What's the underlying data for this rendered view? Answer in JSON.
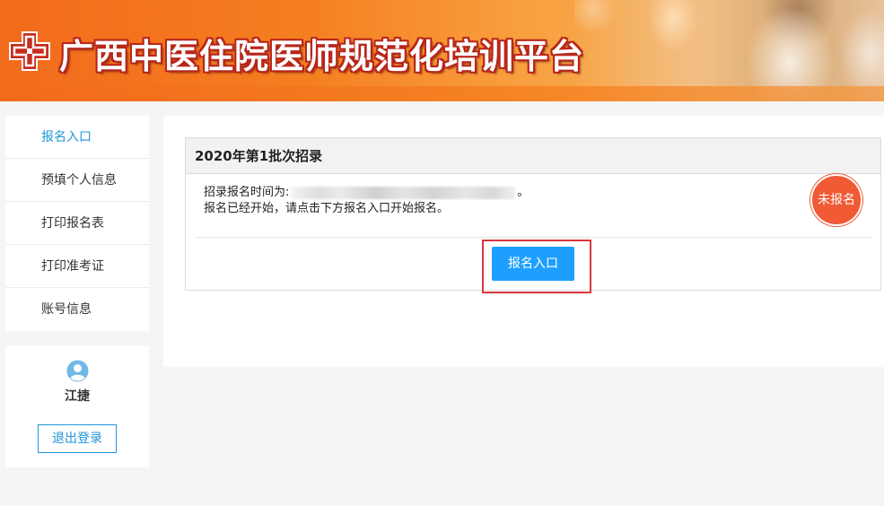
{
  "header": {
    "title": "广西中医住院医师规范化培训平台",
    "logo_icon": "cross-logo-icon"
  },
  "sidebar": {
    "items": [
      {
        "label": "报名入口",
        "active": true
      },
      {
        "label": "预填个人信息",
        "active": false
      },
      {
        "label": "打印报名表",
        "active": false
      },
      {
        "label": "打印准考证",
        "active": false
      },
      {
        "label": "账号信息",
        "active": false
      }
    ]
  },
  "user": {
    "avatar_icon": "user-avatar-icon",
    "name": "江捷",
    "logout_label": "退出登录"
  },
  "main": {
    "batch_title": "2020年第1批次招录",
    "time_label": "招录报名时间为:",
    "time_end": "。",
    "message": "报名已经开始，请点击下方报名入口开始报名。",
    "status_badge": "未报名",
    "register_button": "报名入口"
  },
  "colors": {
    "accent": "#2196d9",
    "button": "#1e9fff",
    "badge": "#f05a35",
    "highlight": "#d9363e",
    "header_orange": "#f57f20"
  }
}
